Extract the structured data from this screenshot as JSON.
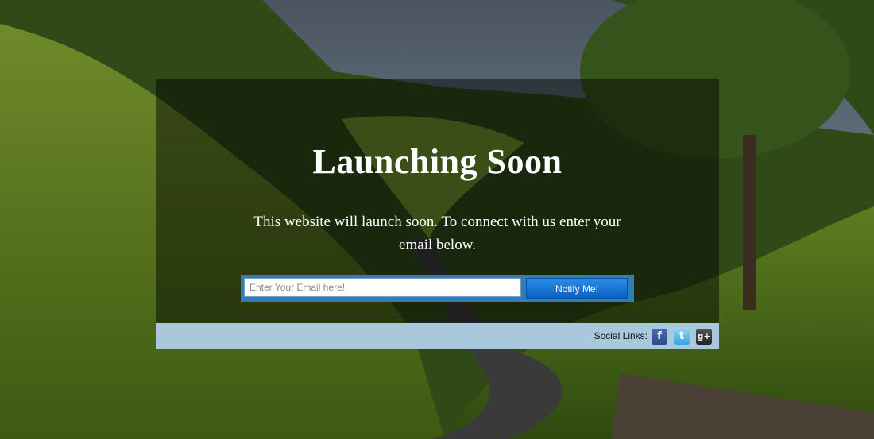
{
  "hero": {
    "title": "Launching Soon",
    "description": "This website will launch soon. To connect with us enter your email below."
  },
  "signup": {
    "email_placeholder": "Enter Your Email here!",
    "email_value": "",
    "notify_label": "Notify Me!"
  },
  "social": {
    "label": "Social Links:",
    "links": [
      {
        "name": "facebook-icon",
        "glyph": "f"
      },
      {
        "name": "twitter-icon",
        "glyph": "t"
      },
      {
        "name": "google-plus-icon",
        "glyph": "g+"
      }
    ]
  },
  "colors": {
    "panel_overlay": "#000000",
    "form_frame": "#2e7fb6",
    "button": "#0a6fd6",
    "social_bar": "#a9c8dc"
  }
}
